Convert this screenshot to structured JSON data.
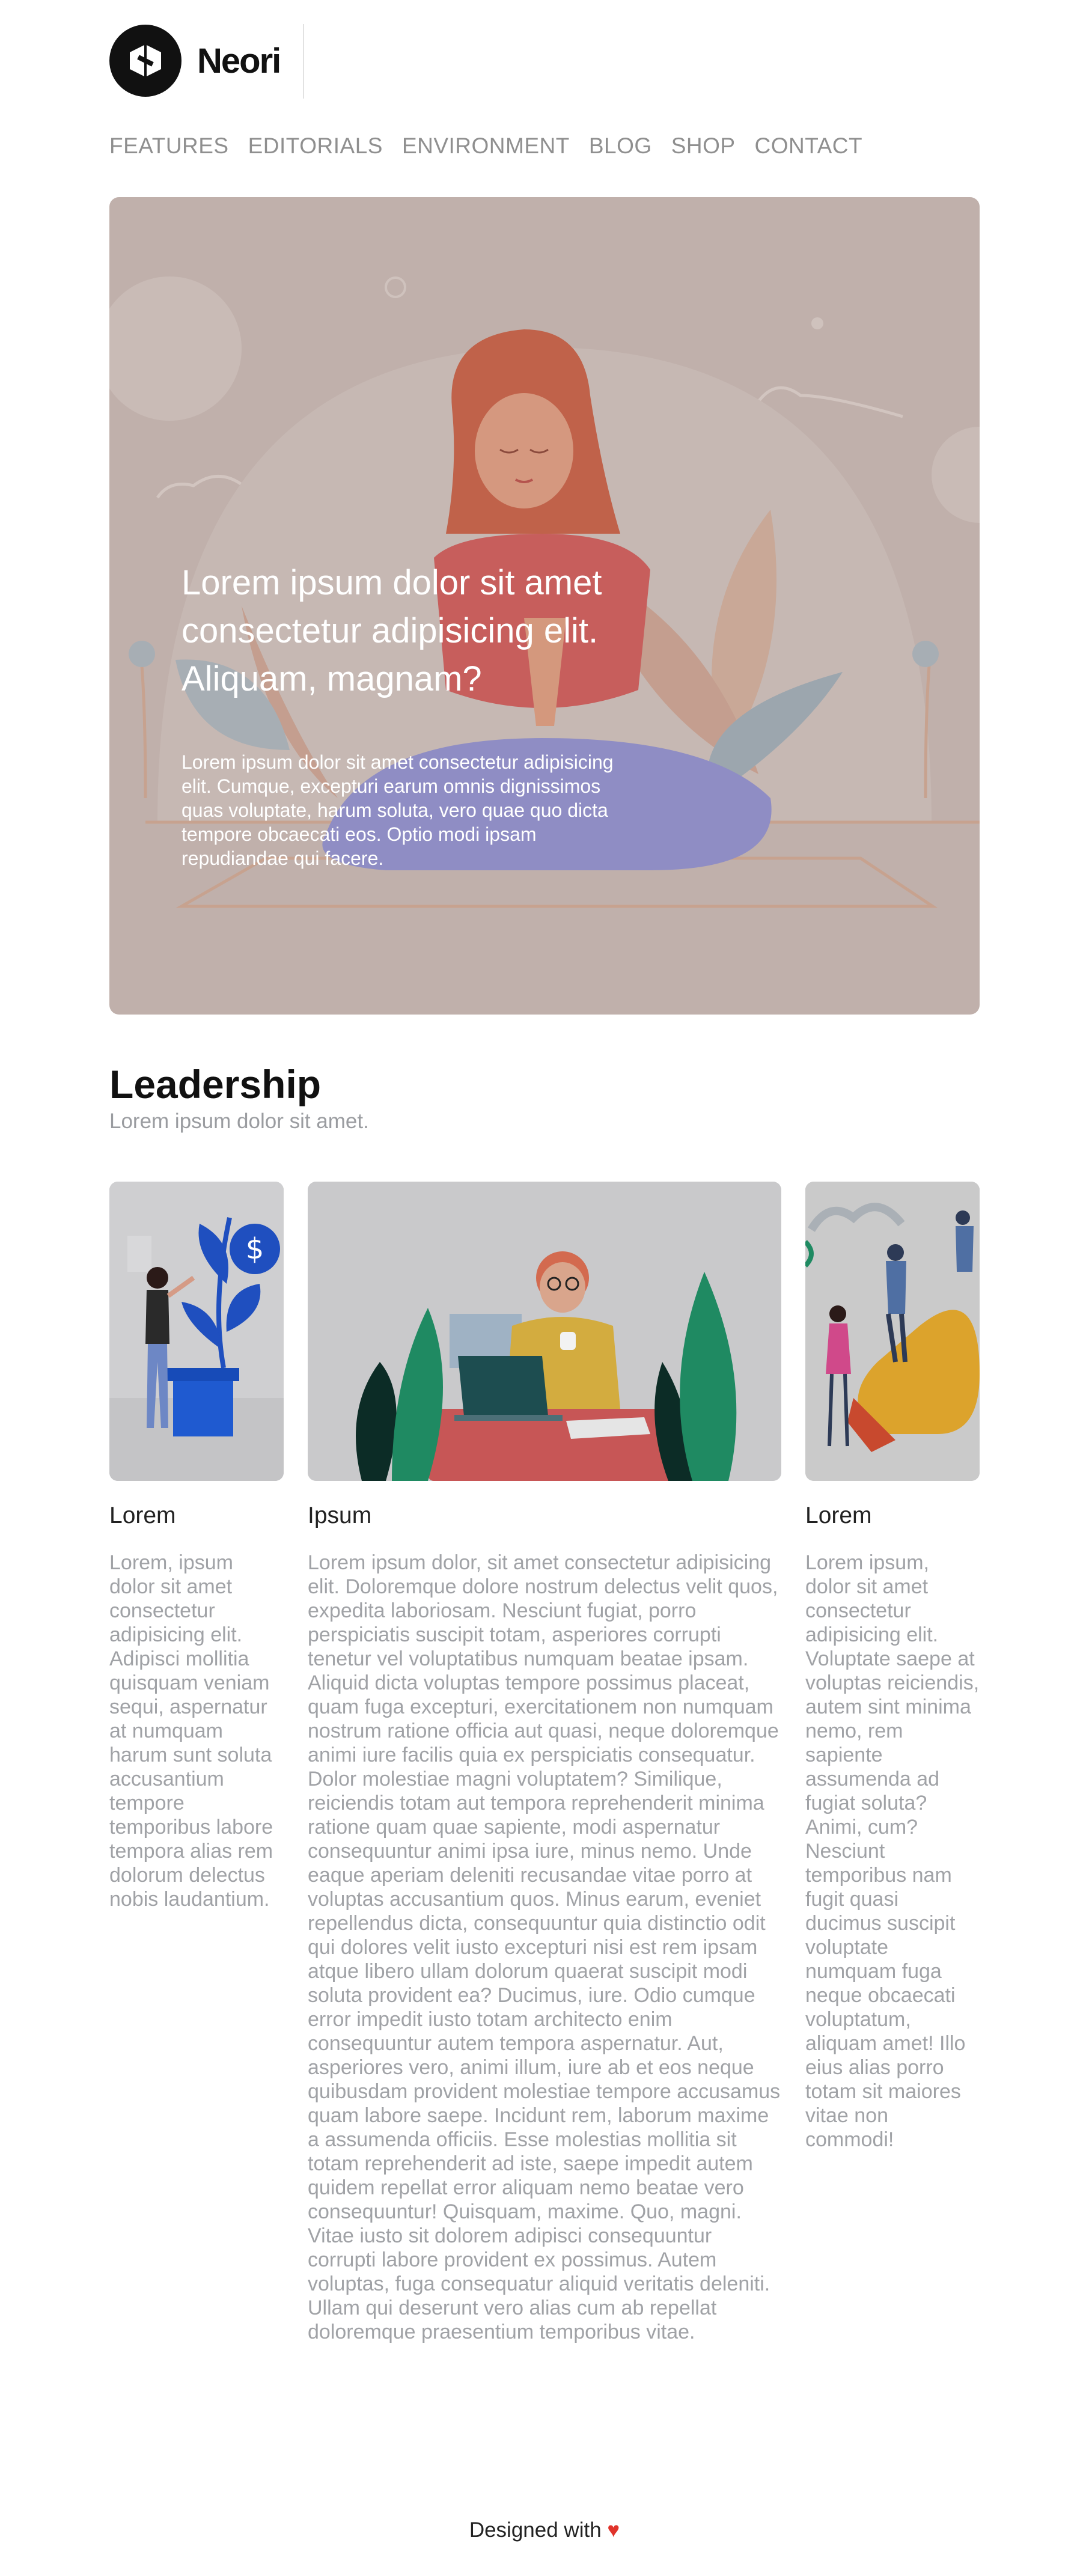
{
  "brand": {
    "name": "Neori"
  },
  "nav": {
    "items": [
      "FEATURES",
      "EDITORIALS",
      "ENVIRONMENT",
      "BLOG",
      "SHOP",
      "CONTACT"
    ]
  },
  "hero": {
    "title": "Lorem ipsum dolor sit amet consectetur adipisicing elit. Aliquam, magnam?",
    "body": "Lorem ipsum dolor sit amet consectetur adipisicing elit. Cumque, excepturi earum omnis dignissimos quas voluptate, harum soluta, vero quae quo dicta tempore obcaecati eos. Optio modi ipsam repudiandae qui facere."
  },
  "leadership": {
    "title": "Leadership",
    "subtitle": "Lorem ipsum dolor sit amet.",
    "cards": [
      {
        "name": "Lorem",
        "text": "Lorem, ipsum dolor sit amet consectetur adipisicing elit. Adipisci mollitia quisquam veniam sequi, aspernatur at numquam harum sunt soluta accusantium tempore temporibus labore tempora alias rem dolorum delectus nobis laudantium."
      },
      {
        "name": "Ipsum",
        "text": "Lorem ipsum dolor, sit amet consectetur adipisicing elit. Doloremque dolore nostrum delectus velit quos, expedita laboriosam. Nesciunt fugiat, porro perspiciatis suscipit totam, asperiores corrupti tenetur vel voluptatibus numquam beatae ipsam. Aliquid dicta voluptas tempore possimus placeat, quam fuga excepturi, exercitationem non numquam nostrum ratione officia aut quasi, neque doloremque animi iure facilis quia ex perspiciatis consequatur. Dolor molestiae magni voluptatem? Similique, reiciendis totam aut tempora reprehenderit minima ratione quam quae sapiente, modi aspernatur consequuntur animi ipsa iure, minus nemo. Unde eaque aperiam deleniti recusandae vitae porro at voluptas accusantium quos. Minus earum, eveniet repellendus dicta, consequuntur quia distinctio odit qui dolores velit iusto excepturi nisi est rem ipsam atque libero ullam dolorum quaerat suscipit modi soluta provident ea? Ducimus, iure. Odio cumque error impedit iusto totam architecto enim consequuntur autem tempora aspernatur. Aut, asperiores vero, animi illum, iure ab et eos neque quibusdam provident molestiae tempore accusamus quam labore saepe. Incidunt rem, laborum maxime a assumenda officiis. Esse molestias mollitia sit totam reprehenderit ad iste, saepe impedit autem quidem repellat error aliquam nemo beatae vero consequuntur! Quisquam, maxime. Quo, magni. Vitae iusto sit dolorem adipisci consequuntur corrupti labore provident ex possimus. Autem voluptas, fuga consequatur aliquid veritatis deleniti. Ullam qui deserunt vero alias cum ab repellat doloremque praesentium temporibus vitae."
      },
      {
        "name": "Lorem",
        "text": "Lorem ipsum, dolor sit amet consectetur adipisicing elit. Voluptate saepe at voluptas reiciendis, autem sint minima nemo, rem sapiente assumenda ad fugiat soluta? Animi, cum? Nesciunt temporibus nam fugit quasi ducimus suscipit voluptate numquam fuga neque obcaecati voluptatum, aliquam amet! Illo eius alias porro totam sit maiores vitae non commodi!"
      }
    ]
  },
  "footer": {
    "text": "Designed with",
    "heart": "♥"
  },
  "colors": {
    "hero_bg": "#c0b0ab",
    "heart": "#e0332b",
    "card_bg": "#c9c9cb"
  }
}
